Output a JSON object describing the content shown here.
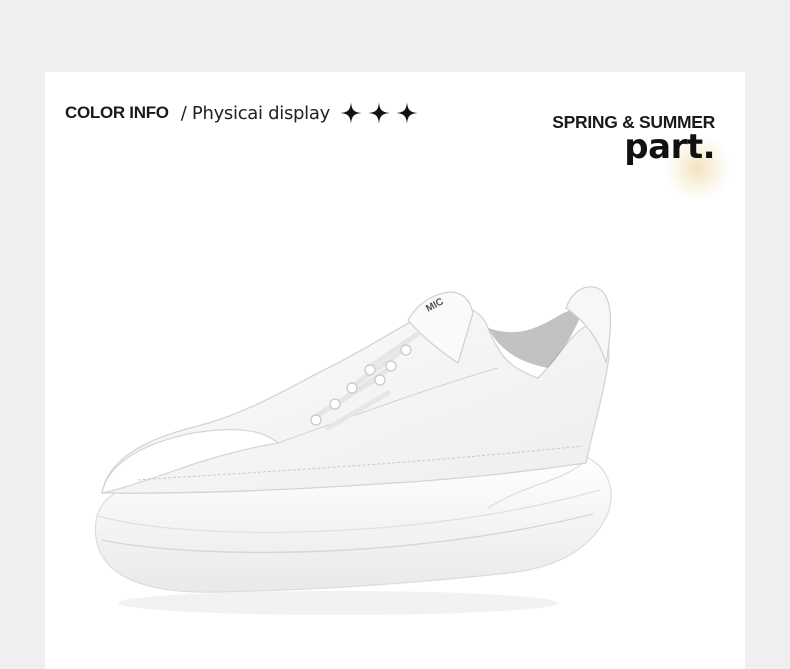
{
  "header": {
    "color_info": "COLOR INFO",
    "subtitle": "/ Physicai display",
    "sparkle_icons": [
      "sparkle-icon",
      "sparkle-icon",
      "sparkle-icon"
    ]
  },
  "badge": {
    "season": "SPRING & SUMMER",
    "part": "part."
  },
  "product": {
    "image": "white-platform-sneaker",
    "tongue_label": "MIC"
  },
  "colors": {
    "background": "#efefef",
    "card": "#ffffff",
    "text": "#1a1a1a",
    "glow": "#e8cd8c"
  }
}
